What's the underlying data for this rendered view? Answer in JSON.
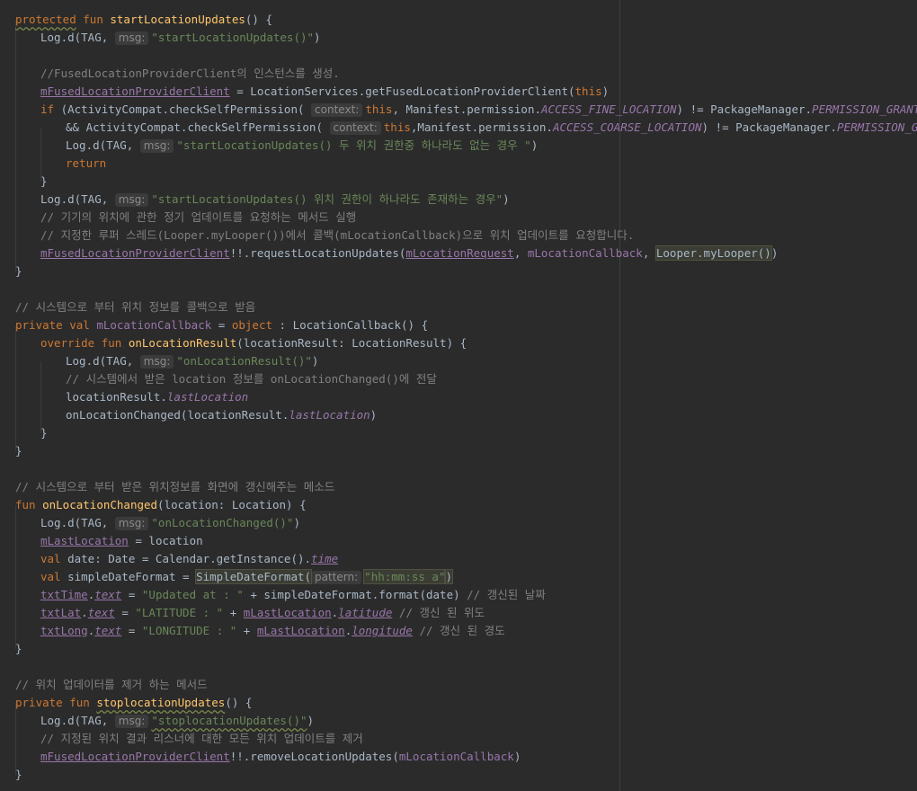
{
  "editor": {
    "hints": {
      "msg": "msg:",
      "context": "context:",
      "pattern": "pattern:"
    },
    "colors": {
      "background": "#2b2b2b",
      "keyword": "#cc7832",
      "function": "#ffc66d",
      "string": "#6a8759",
      "comment": "#808080",
      "field": "#9876aa",
      "default": "#a9b7c6"
    },
    "lines": [
      [
        {
          "t": "protected",
          "c": "kw wavy"
        },
        {
          "t": " "
        },
        {
          "t": "fun",
          "c": "kw"
        },
        {
          "t": " "
        },
        {
          "t": "startLocationUpdates",
          "c": "fn"
        },
        {
          "t": "() {"
        }
      ],
      [
        {
          "t": "Log.d(TAG, "
        },
        {
          "h": "msg"
        },
        {
          "t": "\"startLocationUpdates()\"",
          "c": "str"
        },
        {
          "t": ")"
        }
      ],
      [],
      [
        {
          "t": "//FusedLocationProviderClient의 인스턴스를 생성.",
          "c": "cm"
        }
      ],
      [
        {
          "t": "mFusedLocationProviderClient",
          "c": "field ul"
        },
        {
          "t": " = LocationServices.getFusedLocationProviderClient("
        },
        {
          "t": "this",
          "c": "kw"
        },
        {
          "t": ")"
        }
      ],
      [
        {
          "t": "if",
          "c": "kw"
        },
        {
          "t": " (ActivityCompat.checkSelfPermission( "
        },
        {
          "h": "context"
        },
        {
          "t": "this",
          "c": "kw"
        },
        {
          "t": ", Manifest.permission."
        },
        {
          "t": "ACCESS_FINE_LOCATION",
          "c": "fieldi"
        },
        {
          "t": ") != PackageManager."
        },
        {
          "t": "PERMISSION_GRANTED",
          "c": "fieldi"
        }
      ],
      [
        {
          "t": "&& ActivityCompat.checkSelfPermission( "
        },
        {
          "h": "context"
        },
        {
          "t": "this",
          "c": "kw"
        },
        {
          "t": ",Manifest.permission."
        },
        {
          "t": "ACCESS_COARSE_LOCATION",
          "c": "fieldi"
        },
        {
          "t": ") != PackageManager."
        },
        {
          "t": "PERMISSION_GRANTED",
          "c": "fieldi"
        },
        {
          "t": ") {"
        }
      ],
      [
        {
          "t": "Log.d(TAG, "
        },
        {
          "h": "msg"
        },
        {
          "t": "\"startLocationUpdates() 두 위치 권한중 하나라도 없는 경우 \"",
          "c": "str"
        },
        {
          "t": ")"
        }
      ],
      [
        {
          "t": "return",
          "c": "kw"
        }
      ],
      [
        {
          "t": "}"
        }
      ],
      [
        {
          "t": "Log.d(TAG, "
        },
        {
          "h": "msg"
        },
        {
          "t": "\"startLocationUpdates() 위치 권한이 하나라도 존재하는 경우\"",
          "c": "str"
        },
        {
          "t": ")"
        }
      ],
      [
        {
          "t": "// 기기의 위치에 관한 정기 업데이트를 요청하는 메서드 실행",
          "c": "cm"
        }
      ],
      [
        {
          "t": "// 지정한 루퍼 스레드(Looper.myLooper())에서 콜백(mLocationCallback)으로 위치 업데이트를 요청합니다.",
          "c": "cm"
        }
      ],
      [
        {
          "t": "mFusedLocationProviderClient",
          "c": "field ul"
        },
        {
          "t": "!!.requestLocationUpdates("
        },
        {
          "t": "mLocationRequest",
          "c": "field ul"
        },
        {
          "t": ", "
        },
        {
          "t": "mLocationCallback",
          "c": "field"
        },
        {
          "t": ", "
        },
        {
          "t": "Looper.myLooper()",
          "c": "hl"
        },
        {
          "t": ")"
        }
      ],
      [
        {
          "t": "}"
        }
      ],
      [],
      [
        {
          "t": "// 시스템으로 부터 위치 정보를 콜백으로 받음",
          "c": "cm"
        }
      ],
      [
        {
          "t": "private",
          "c": "kw"
        },
        {
          "t": " "
        },
        {
          "t": "val",
          "c": "kw"
        },
        {
          "t": " "
        },
        {
          "t": "mLocationCallback",
          "c": "field"
        },
        {
          "t": " = "
        },
        {
          "t": "object",
          "c": "kw"
        },
        {
          "t": " : LocationCallback() {"
        }
      ],
      [
        {
          "t": "override",
          "c": "kw"
        },
        {
          "t": " "
        },
        {
          "t": "fun",
          "c": "kw"
        },
        {
          "t": " "
        },
        {
          "t": "onLocationResult",
          "c": "fn"
        },
        {
          "t": "(locationResult: LocationResult) {"
        }
      ],
      [
        {
          "t": "Log.d(TAG, "
        },
        {
          "h": "msg"
        },
        {
          "t": "\"onLocationResult()\"",
          "c": "str"
        },
        {
          "t": ")"
        }
      ],
      [
        {
          "t": "// 시스템에서 받은 location 정보를 onLocationChanged()에 전달",
          "c": "cm"
        }
      ],
      [
        {
          "t": "locationResult."
        },
        {
          "t": "lastLocation",
          "c": "propi"
        }
      ],
      [
        {
          "t": "onLocationChanged(locationResult."
        },
        {
          "t": "lastLocation",
          "c": "propi"
        },
        {
          "t": ")"
        }
      ],
      [
        {
          "t": "}"
        }
      ],
      [
        {
          "t": "}"
        }
      ],
      [],
      [
        {
          "t": "// 시스템으로 부터 받은 위치정보를 화면에 갱신해주는 메소드",
          "c": "cm"
        }
      ],
      [
        {
          "t": "fun",
          "c": "kw"
        },
        {
          "t": " "
        },
        {
          "t": "onLocationChanged",
          "c": "fn"
        },
        {
          "t": "(location: Location) {"
        }
      ],
      [
        {
          "t": "Log.d(TAG, "
        },
        {
          "h": "msg"
        },
        {
          "t": "\"onLocationChanged()\"",
          "c": "str"
        },
        {
          "t": ")"
        }
      ],
      [
        {
          "t": "mLastLocation",
          "c": "field ul"
        },
        {
          "t": " = location"
        }
      ],
      [
        {
          "t": "val",
          "c": "kw"
        },
        {
          "t": " date: Date = Calendar.getInstance()."
        },
        {
          "t": "time",
          "c": "propi ul"
        }
      ],
      [
        {
          "t": "val",
          "c": "kw"
        },
        {
          "t": " simpleDateFormat = "
        },
        {
          "t": "SimpleDateFormat(",
          "c": "hl"
        },
        {
          "h": "pattern"
        },
        {
          "t": "\"hh:mm:ss a\"",
          "c": "str hl"
        },
        {
          "t": ")",
          "c": "hl"
        }
      ],
      [
        {
          "t": "txtTime",
          "c": "field ul"
        },
        {
          "t": "."
        },
        {
          "t": "text",
          "c": "propi ul"
        },
        {
          "t": " = "
        },
        {
          "t": "\"Updated at : \"",
          "c": "str"
        },
        {
          "t": " + simpleDateFormat.format(date) "
        },
        {
          "t": "// 갱신된 날짜",
          "c": "cm"
        }
      ],
      [
        {
          "t": "txtLat",
          "c": "field ul"
        },
        {
          "t": "."
        },
        {
          "t": "text",
          "c": "propi ul"
        },
        {
          "t": " = "
        },
        {
          "t": "\"LATITUDE : \"",
          "c": "str"
        },
        {
          "t": " + "
        },
        {
          "t": "mLastLocation",
          "c": "field ul"
        },
        {
          "t": "."
        },
        {
          "t": "latitude",
          "c": "propi ul"
        },
        {
          "t": " "
        },
        {
          "t": "// 갱신 된 위도",
          "c": "cm"
        }
      ],
      [
        {
          "t": "txtLong",
          "c": "field ul"
        },
        {
          "t": "."
        },
        {
          "t": "text",
          "c": "propi ul"
        },
        {
          "t": " = "
        },
        {
          "t": "\"LONGITUDE : \"",
          "c": "str"
        },
        {
          "t": " + "
        },
        {
          "t": "mLastLocation",
          "c": "field ul"
        },
        {
          "t": "."
        },
        {
          "t": "longitude",
          "c": "propi ul"
        },
        {
          "t": " "
        },
        {
          "t": "// 갱신 된 경도",
          "c": "cm"
        }
      ],
      [
        {
          "t": "}"
        }
      ],
      [],
      [
        {
          "t": "// 위치 업데이터를 제거 하는 메서드",
          "c": "cm"
        }
      ],
      [
        {
          "t": "private",
          "c": "kw"
        },
        {
          "t": " "
        },
        {
          "t": "fun",
          "c": "kw"
        },
        {
          "t": " "
        },
        {
          "t": "stoplocationUpdates",
          "c": "fn wavy"
        },
        {
          "t": "() {"
        }
      ],
      [
        {
          "t": "Log.d(TAG, "
        },
        {
          "h": "msg"
        },
        {
          "t": "\"stoplocationUpdates()\"",
          "c": "str wavy"
        },
        {
          "t": ")"
        }
      ],
      [
        {
          "t": "// 지정된 위치 결과 리스너에 대한 모든 위치 업데이트를 제거",
          "c": "cm"
        }
      ],
      [
        {
          "t": "mFusedLocationProviderClient",
          "c": "field ul"
        },
        {
          "t": "!!.removeLocationUpdates("
        },
        {
          "t": "mLocationCallback",
          "c": "field"
        },
        {
          "t": ")"
        }
      ],
      [
        {
          "t": "}"
        }
      ]
    ]
  }
}
